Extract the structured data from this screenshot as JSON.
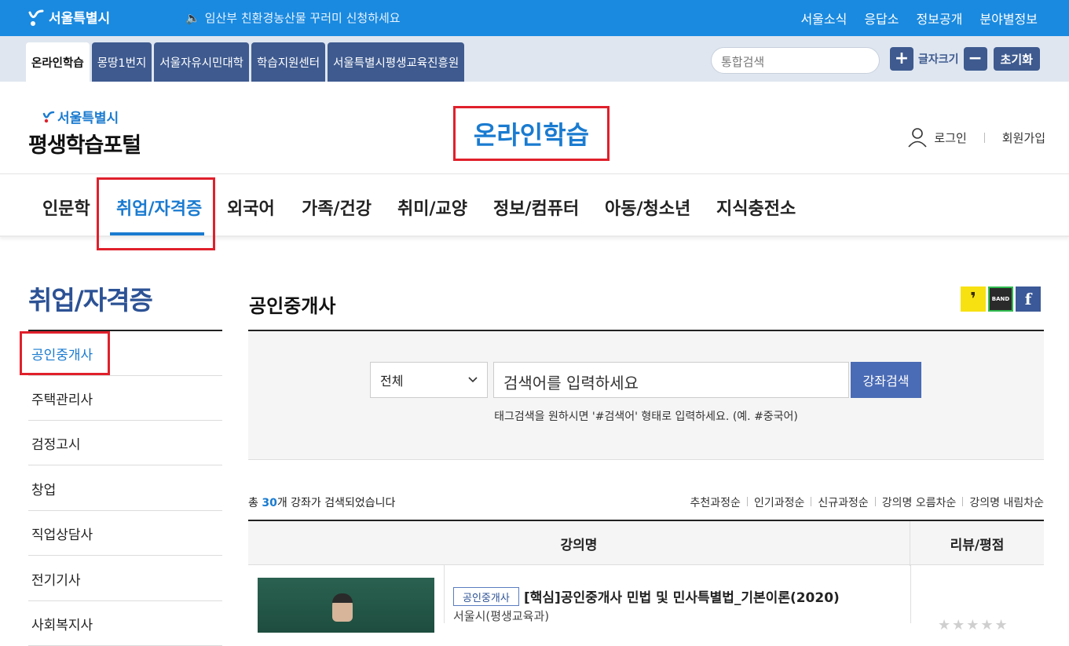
{
  "topbar": {
    "logo_text": "서울특별시",
    "notice": "임산부 친환경농산물 꾸러미 신청하세요",
    "links": [
      "서울소식",
      "응답소",
      "정보공개",
      "분야별정보"
    ]
  },
  "tabs": [
    {
      "label": "온라인학습",
      "active": true
    },
    {
      "label": "몽땅1번지",
      "active": false
    },
    {
      "label": "서울자유시민대학",
      "active": false
    },
    {
      "label": "학습지원센터",
      "active": false
    },
    {
      "label": "서울특별시평생교육진흥원",
      "active": false
    }
  ],
  "global_search": {
    "placeholder": "통합검색"
  },
  "font_size": {
    "plus": "+",
    "label": "글자크기",
    "minus": "−",
    "reset": "초기화"
  },
  "header": {
    "logo_small": "서울특별시",
    "logo_big": "평생학습포털",
    "page_heading": "온라인학습",
    "login": "로그인",
    "signup": "회원가입"
  },
  "categories": [
    {
      "label": "인문학",
      "active": false
    },
    {
      "label": "취업/자격증",
      "active": true
    },
    {
      "label": "외국어",
      "active": false
    },
    {
      "label": "가족/건강",
      "active": false
    },
    {
      "label": "취미/교양",
      "active": false
    },
    {
      "label": "정보/컴퓨터",
      "active": false
    },
    {
      "label": "아동/청소년",
      "active": false
    },
    {
      "label": "지식충전소",
      "active": false
    }
  ],
  "sidebar": {
    "title": "취업/자격증",
    "items": [
      {
        "label": "공인중개사",
        "active": true
      },
      {
        "label": "주택관리사",
        "active": false
      },
      {
        "label": "검정고시",
        "active": false
      },
      {
        "label": "창업",
        "active": false
      },
      {
        "label": "직업상담사",
        "active": false
      },
      {
        "label": "전기기사",
        "active": false
      },
      {
        "label": "사회복지사",
        "active": false
      }
    ]
  },
  "main": {
    "title": "공인중개사",
    "share": {
      "kakao": "❜",
      "band": "BAND",
      "facebook": "f"
    },
    "search": {
      "select_value": "전체",
      "placeholder": "검색어를 입력하세요",
      "button": "강좌검색",
      "hint": "태그검색을 원하시면 '#검색어' 형태로 입력하세요. (예. #중국어)"
    },
    "result": {
      "prefix": "총 ",
      "count": "30",
      "suffix": "개 강좌가 검색되었습니다"
    },
    "sorts": [
      "추천과정순",
      "인기과정순",
      "신규과정순",
      "강의명 오름차순",
      "강의명 내림차순"
    ],
    "table": {
      "col_title": "강의명",
      "col_review": "리뷰/평점",
      "rows": [
        {
          "tag": "공인중개사",
          "title": "[핵심]공인중개사 민법 및 민사특별법_기본이론(2020)",
          "dept": "서울시(평생교육과)",
          "rating": 0
        }
      ]
    }
  },
  "colors": {
    "primary": "#1a8ae0",
    "navy": "#3e5a8f",
    "accent": "#1a7bd0",
    "highlight_box": "#e0202b"
  }
}
